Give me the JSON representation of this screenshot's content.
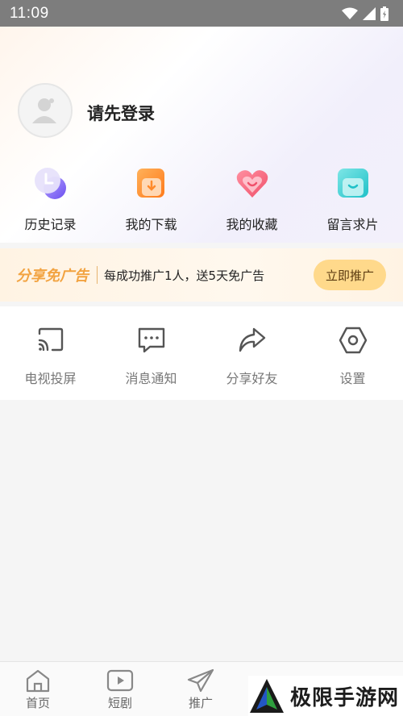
{
  "status_bar": {
    "time": "11:09",
    "icons": [
      "wifi-icon",
      "signal-icon",
      "battery-icon"
    ]
  },
  "profile": {
    "login_prompt": "请先登录",
    "avatar_icon": "avatar-placeholder-icon"
  },
  "quick_actions": [
    {
      "label": "历史记录",
      "icon": "history-icon"
    },
    {
      "label": "我的下载",
      "icon": "download-icon"
    },
    {
      "label": "我的收藏",
      "icon": "favorite-icon"
    },
    {
      "label": "留言求片",
      "icon": "message-request-icon"
    }
  ],
  "promo": {
    "title": "分享免广告",
    "text": "每成功推广1人，送5天免广告",
    "button": "立即推广",
    "colors": {
      "accent": "#f2a341",
      "button_bg": "#ffd98b"
    }
  },
  "tools": [
    {
      "label": "电视投屏",
      "icon": "cast-icon"
    },
    {
      "label": "消息通知",
      "icon": "chat-icon"
    },
    {
      "label": "分享好友",
      "icon": "share-icon"
    },
    {
      "label": "设置",
      "icon": "settings-icon"
    }
  ],
  "bottom_nav": [
    {
      "label": "首页",
      "icon": "home-icon"
    },
    {
      "label": "短剧",
      "icon": "play-icon"
    },
    {
      "label": "推广",
      "icon": "send-icon"
    }
  ],
  "watermark": {
    "text": "极限手游网"
  }
}
